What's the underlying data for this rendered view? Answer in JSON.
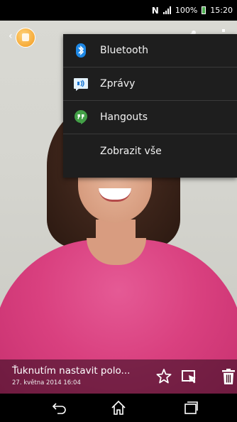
{
  "status_bar": {
    "nfc": "N",
    "battery_percent": "100%",
    "time": "15:20",
    "battery_color": "#4caf50"
  },
  "action_bar": {
    "back_icon": "chevron-left-icon",
    "app_icon": "album-app-icon",
    "share_icon": "share-icon",
    "overflow_icon": "more-vertical-icon"
  },
  "share_menu": {
    "items": [
      {
        "label": "Bluetooth",
        "icon": "bluetooth-icon",
        "color": "#1e88e5"
      },
      {
        "label": "Zprávy",
        "icon": "messages-icon",
        "color": "#e3f2fd"
      },
      {
        "label": "Hangouts",
        "icon": "hangouts-icon",
        "color": "#43a047"
      },
      {
        "label": "Zobrazit vše",
        "icon": ""
      }
    ]
  },
  "photo_info": {
    "title": "Ťuknutím nastavit polo...",
    "date": "27. května 2014 16:04"
  },
  "photo_actions": {
    "favorite_icon": "star-outline-icon",
    "set_as_icon": "set-as-icon",
    "delete_icon": "trash-icon"
  },
  "nav_bar": {
    "back_icon": "back-arrow-icon",
    "home_icon": "home-icon",
    "recents_icon": "recents-icon"
  }
}
